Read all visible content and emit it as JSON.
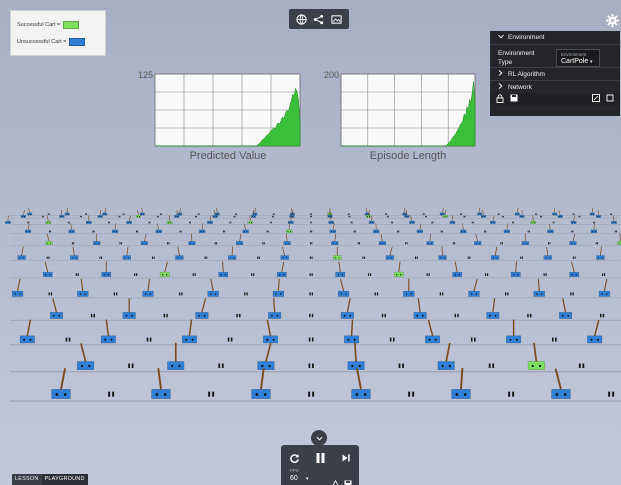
{
  "legend": {
    "successful_label": "Successful Cart =",
    "unsuccessful_label": "Unsuccessful Cart =",
    "successful_color": "#7ee05e",
    "unsuccessful_color": "#2f7fd6"
  },
  "toolbar": {
    "buttons": [
      "globe-icon",
      "share-icon",
      "image-icon"
    ]
  },
  "settings_icon": "gear-icon",
  "environment_panel": {
    "header": "Environment",
    "type_label": "Environment Type",
    "select_small_label": "Environment",
    "select_value": "CartPole",
    "items": [
      "RL Algorithm",
      "Network"
    ],
    "footer_icons": [
      "lock-icon",
      "save-icon",
      "fullscreen-icon",
      "square-icon"
    ]
  },
  "charts": [
    {
      "title": "Predicted Value",
      "ymax_label": "125",
      "ylim": [
        0,
        125
      ],
      "fill_color": "#3bbf3b",
      "values": [
        0,
        0,
        0,
        0,
        0,
        0,
        0,
        0,
        0,
        0,
        0,
        0,
        0,
        0,
        0,
        0,
        0,
        0,
        0,
        0,
        0,
        0,
        0,
        0,
        0,
        0,
        0,
        0,
        0,
        0,
        0,
        0,
        0,
        0,
        0,
        0,
        0,
        0,
        0,
        0,
        0,
        0,
        0,
        0,
        0,
        0,
        0,
        0,
        0,
        0,
        0,
        0,
        0,
        0,
        0,
        0,
        0,
        0,
        0,
        0,
        0,
        0,
        0,
        0,
        0,
        0,
        0,
        0,
        0,
        0,
        2,
        4,
        6,
        10,
        12,
        14,
        18,
        20,
        22,
        26,
        28,
        32,
        30,
        36,
        40,
        38,
        44,
        50,
        48,
        56,
        62,
        58,
        70,
        78,
        90,
        88,
        100,
        94,
        80,
        40
      ]
    },
    {
      "title": "Episode Length",
      "ymax_label": "200",
      "ylim": [
        0,
        200
      ],
      "fill_color": "#3bbf3b",
      "values": [
        0,
        0,
        0,
        0,
        0,
        0,
        0,
        0,
        0,
        0,
        0,
        0,
        0,
        0,
        0,
        0,
        0,
        0,
        0,
        0,
        0,
        0,
        0,
        0,
        0,
        0,
        0,
        0,
        0,
        0,
        0,
        0,
        0,
        0,
        0,
        0,
        0,
        0,
        0,
        0,
        0,
        0,
        0,
        0,
        0,
        0,
        0,
        0,
        0,
        0,
        0,
        0,
        0,
        0,
        0,
        0,
        0,
        0,
        0,
        0,
        0,
        0,
        0,
        0,
        0,
        0,
        0,
        0,
        0,
        0,
        0,
        0,
        0,
        0,
        0,
        0,
        0,
        0,
        2,
        6,
        10,
        14,
        20,
        26,
        30,
        36,
        44,
        50,
        58,
        64,
        70,
        90,
        80,
        110,
        100,
        130,
        120,
        150,
        180,
        120
      ]
    }
  ],
  "carts": {
    "cart_color": "#2f7fd6",
    "success_color": "#7ee05e",
    "rows": 12,
    "cols": 16,
    "success_positions": [
      [
        0,
        8
      ],
      [
        1,
        3
      ],
      [
        1,
        9
      ],
      [
        1,
        11
      ],
      [
        2,
        1
      ],
      [
        2,
        4
      ],
      [
        2,
        6
      ],
      [
        2,
        13
      ],
      [
        3,
        7
      ],
      [
        4,
        14
      ],
      [
        4,
        2
      ],
      [
        5,
        8
      ],
      [
        6,
        2
      ],
      [
        6,
        5
      ],
      [
        6,
        9
      ],
      [
        8,
        3
      ],
      [
        10,
        10
      ]
    ]
  },
  "controls": {
    "restart_icon": "restart-icon",
    "pause_icon": "pause-icon",
    "step_icon": "step-forward-icon",
    "fps_label": "FPS",
    "fps_value": "60",
    "collapse_icon": "chevron-down-icon"
  },
  "modes": {
    "lesson": "LESSON",
    "playground": "PLAYGROUND"
  }
}
